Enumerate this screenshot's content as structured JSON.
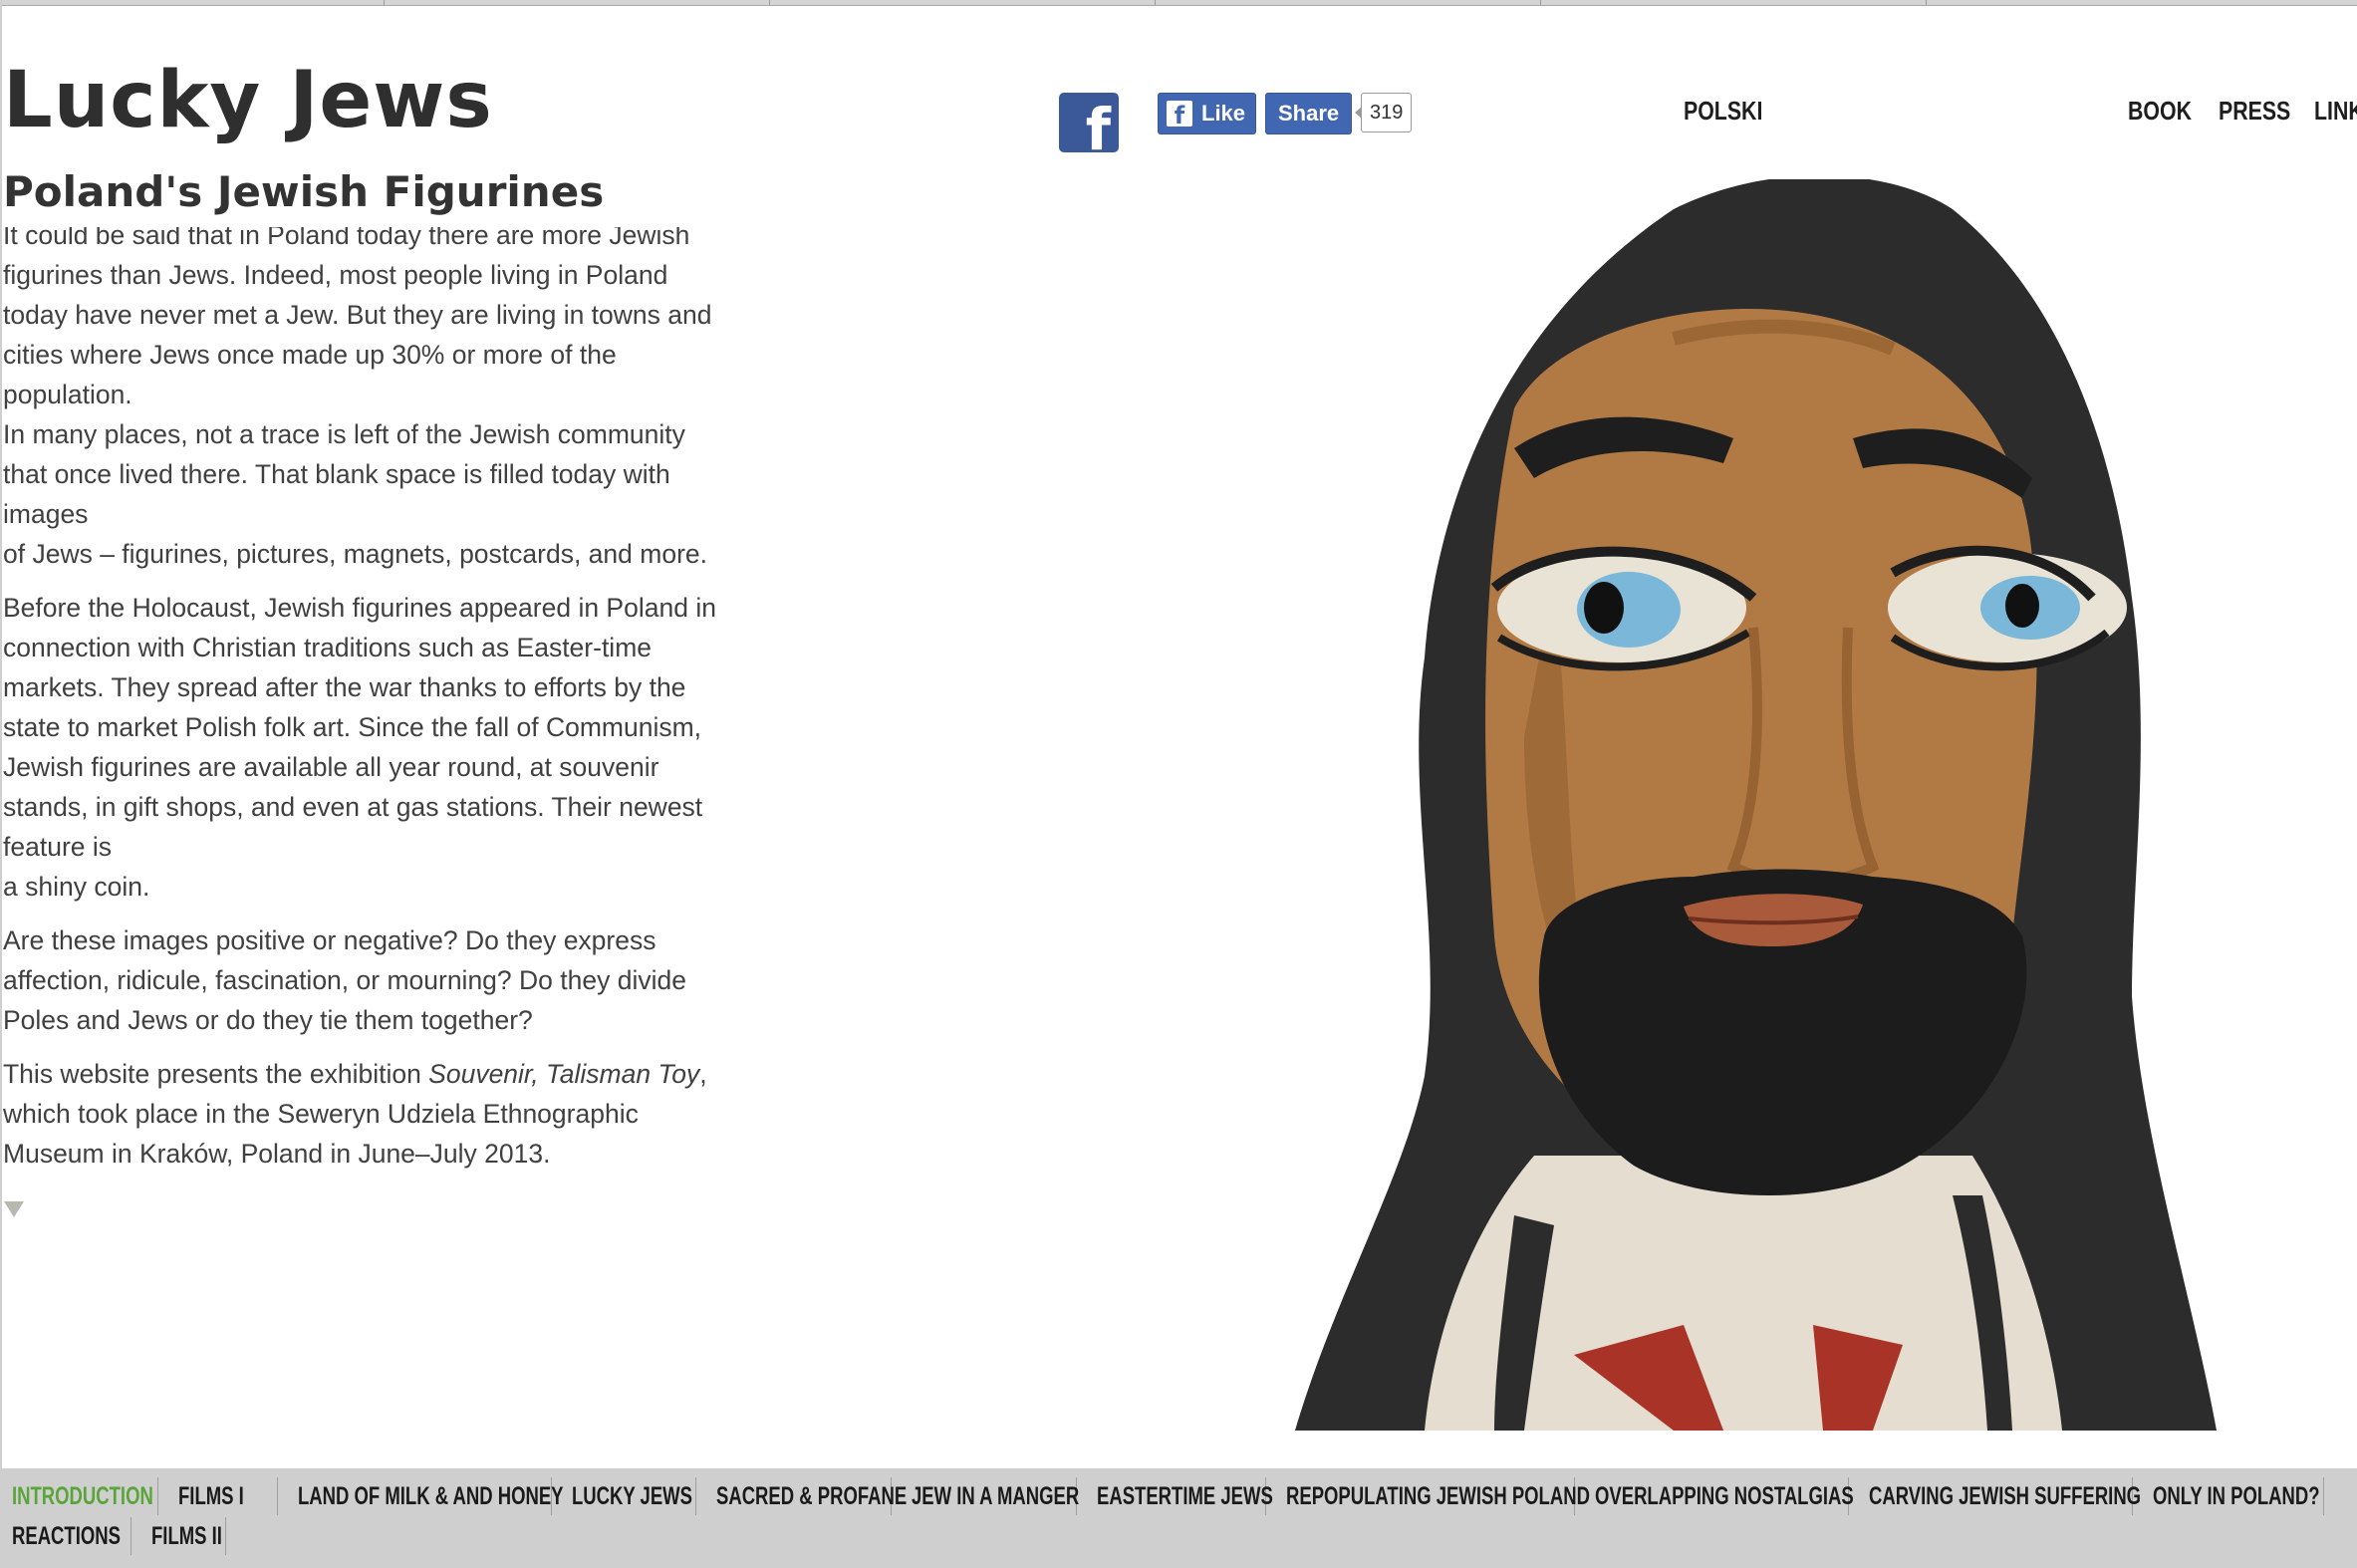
{
  "site": {
    "title": "Lucky Jews",
    "subtitle": "Poland's Jewish Figurines"
  },
  "social": {
    "like_label": "Like",
    "share_label": "Share",
    "share_count": "319",
    "facebook_icon": "facebook-icon"
  },
  "top_nav": {
    "language": "POLSKI",
    "items": [
      "BOOK",
      "PRESS",
      "LINK"
    ]
  },
  "article": {
    "cut_line": "It could be said that in Poland today there are more Jewish",
    "p1": [
      "figurines than Jews. Indeed, most people living in Poland",
      "today have never met a Jew. But they are living in towns and",
      "cities where Jews once made up 30% or more of the",
      "population."
    ],
    "p1b": [
      "In many places, not a trace is left of the Jewish community",
      "that once lived there. That blank space is filled today with",
      "images",
      "of Jews – figurines, pictures, magnets, postcards, and more."
    ],
    "p2": [
      "Before the Holocaust, Jewish figurines appeared in Poland in",
      "connection with Christian traditions such as Easter-time",
      "markets. They spread after the war thanks to efforts by the",
      "state to market Polish folk art. Since the fall of Communism,",
      "Jewish figurines are available all year round, at souvenir",
      "stands, in gift shops, and even at gas stations. Their newest",
      "feature is",
      "a shiny coin."
    ],
    "p3": [
      "Are these images positive or negative? Do they express",
      "affection, ridicule, fascination, or mourning? Do they divide",
      "Poles and Jews or do they tie them together?"
    ],
    "p4_pre": "This website presents the exhibition ",
    "p4_italic": "Souvenir, Talisman Toy",
    "p4_post": ",",
    "p4_rest": [
      "which took place in the Seweryn Udziela Ethnographic",
      "Museum in Kraków, Poland in June–July 2013."
    ],
    "more_icon": "triangle-down-icon"
  },
  "image": {
    "subject": "carved-wooden-figurine",
    "colors": {
      "hood": "#2b2b2b",
      "face": "#b07a42",
      "beard": "#1c1c1c",
      "eye": "#7ab7d8",
      "lips": "#a85a3a"
    }
  },
  "bottom_nav": {
    "active_color": "#5aa43a",
    "row1": [
      "INTRODUCTION",
      "FILMS I",
      "LAND OF MILK & AND HONEY",
      "LUCKY JEWS",
      "SACRED & PROFANE",
      "JEW IN A MANGER",
      "EASTERTIME JEWS",
      "REPOPULATING JEWISH POLAND",
      "OVERLAPPING NOSTALGIAS",
      "CARVING JEWISH SUFFERING",
      "ONLY IN POLAND?"
    ],
    "row2": [
      "REACTIONS",
      "FILMS II"
    ]
  }
}
